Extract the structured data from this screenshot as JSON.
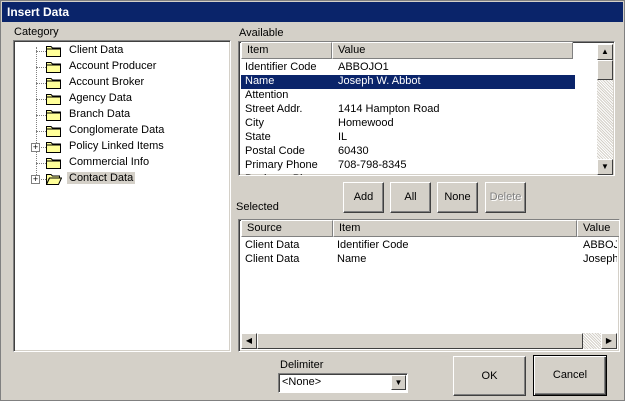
{
  "window": {
    "title": "Insert Data"
  },
  "category": {
    "label": "Category",
    "items": [
      {
        "label": "Client Data",
        "expandable": false
      },
      {
        "label": "Account Producer",
        "expandable": false
      },
      {
        "label": "Account Broker",
        "expandable": false
      },
      {
        "label": "Agency Data",
        "expandable": false
      },
      {
        "label": "Branch Data",
        "expandable": false
      },
      {
        "label": "Conglomerate Data",
        "expandable": false
      },
      {
        "label": "Policy Linked Items",
        "expandable": true
      },
      {
        "label": "Commercial Info",
        "expandable": false
      },
      {
        "label": "Contact Data",
        "expandable": true,
        "selected": true,
        "open_folder": true
      }
    ]
  },
  "available": {
    "label": "Available",
    "columns": [
      "Item",
      "Value"
    ],
    "rows": [
      {
        "item": "Identifier Code",
        "value": "ABBOJO1"
      },
      {
        "item": "Name",
        "value": "Joseph W. Abbot",
        "selected": true
      },
      {
        "item": "Attention",
        "value": ""
      },
      {
        "item": "Street Addr.",
        "value": "1414 Hampton Road"
      },
      {
        "item": "City",
        "value": "Homewood"
      },
      {
        "item": "State",
        "value": "IL"
      },
      {
        "item": "Postal Code",
        "value": "60430"
      },
      {
        "item": "Primary Phone",
        "value": "708-798-8345"
      },
      {
        "item": "Business Phone",
        "value": ""
      }
    ]
  },
  "actions": {
    "add": "Add",
    "all": "All",
    "none": "None",
    "delete": "Delete"
  },
  "selected": {
    "label": "Selected",
    "columns": [
      "Source",
      "Item",
      "Value"
    ],
    "rows": [
      {
        "source": "Client Data",
        "item": "Identifier Code",
        "value": "ABBOJ"
      },
      {
        "source": "Client Data",
        "item": "Name",
        "value": "Joseph"
      }
    ]
  },
  "delimiter": {
    "label": "Delimiter",
    "value": "<None>"
  },
  "footer": {
    "ok": "OK",
    "cancel": "Cancel"
  },
  "colors": {
    "titlebar": "#0a246a",
    "selection": "#0a246a",
    "face": "#d4d0c8",
    "folder": "#ffff99"
  }
}
